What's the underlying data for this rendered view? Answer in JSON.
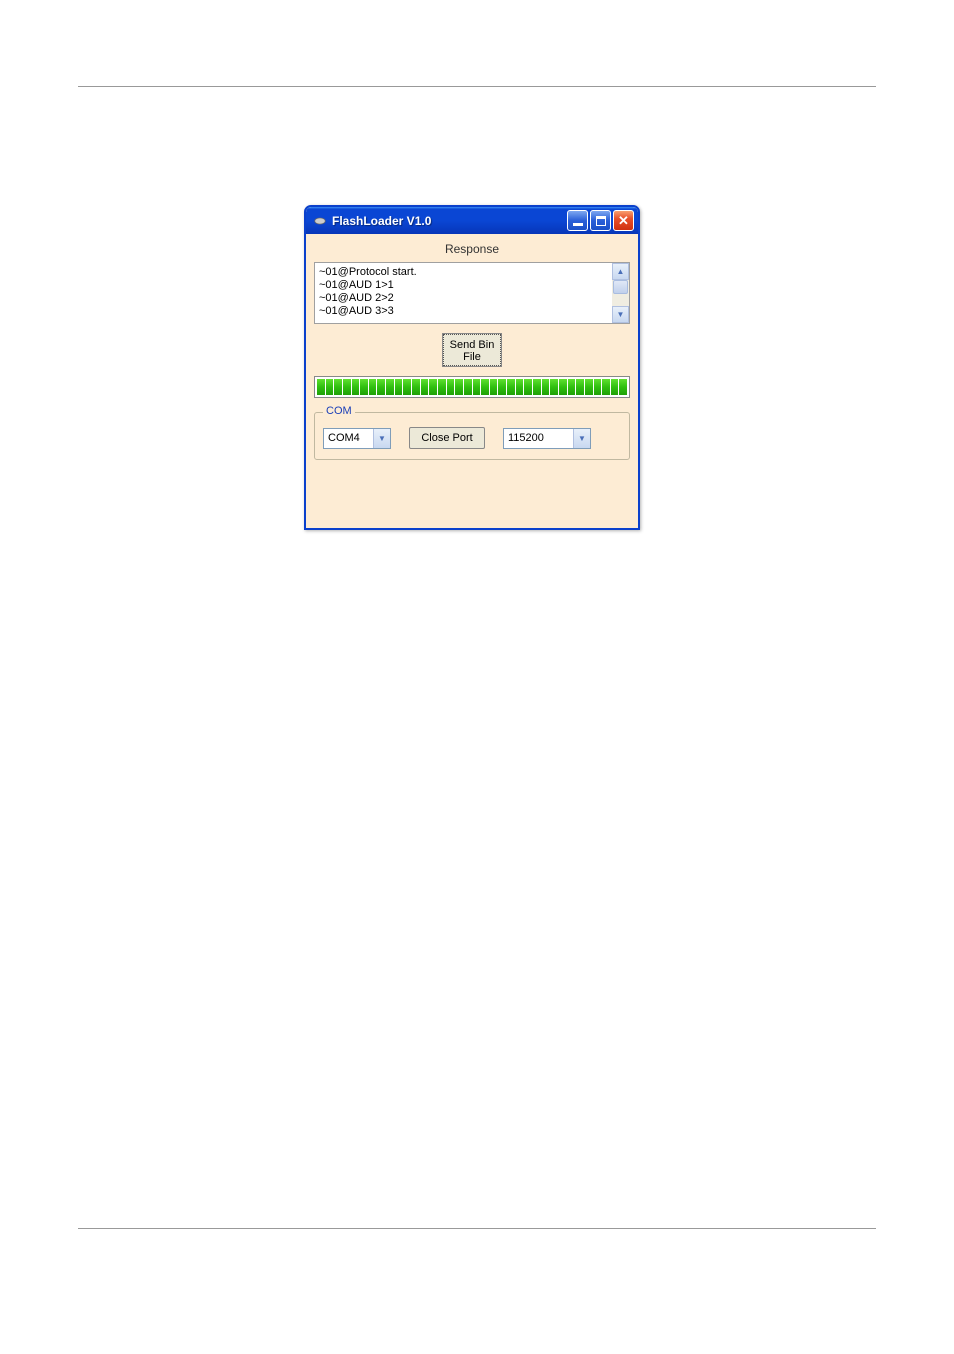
{
  "window": {
    "title": "FlashLoader V1.0"
  },
  "response": {
    "label": "Response",
    "lines": [
      "~01@Protocol start.",
      "~01@AUD 1>1",
      "~01@AUD 2>2",
      "~01@AUD 3>3"
    ]
  },
  "send_button": {
    "line1": "Send Bin",
    "line2": "File"
  },
  "progress": {
    "segments": 36
  },
  "com": {
    "legend": "COM",
    "port_value": "COM4",
    "port_button": "Close Port",
    "baud_value": "115200"
  }
}
